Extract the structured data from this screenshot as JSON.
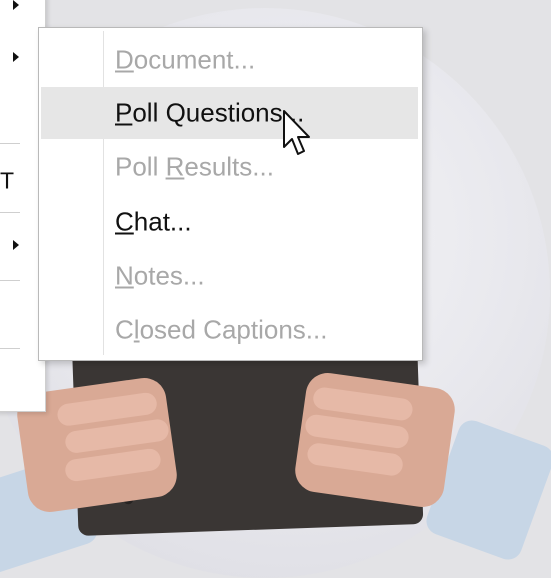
{
  "background": {
    "description_icon": "person-holding-tablet-photo"
  },
  "parent_menu": {
    "rows": [
      {
        "has_arrow": true,
        "text": ""
      },
      {
        "has_arrow": true,
        "text": ""
      },
      {
        "has_arrow": false,
        "text": ""
      },
      {
        "has_arrow": false,
        "text": "T"
      },
      {
        "has_arrow": true,
        "text": ""
      },
      {
        "has_arrow": false,
        "text": ""
      }
    ]
  },
  "submenu": {
    "items": [
      {
        "label_u": "D",
        "label_rest": "ocument...",
        "label_pre": "",
        "enabled": false
      },
      {
        "label_u": "P",
        "label_rest": "oll Questions...",
        "label_pre": "",
        "enabled": true,
        "hover": true
      },
      {
        "label_pre": "Poll ",
        "label_u": "R",
        "label_rest": "esults...",
        "enabled": false
      },
      {
        "label_pre": "",
        "label_u": "C",
        "label_rest": "hat...",
        "enabled": true
      },
      {
        "label_pre": "",
        "label_u": "N",
        "label_rest": "otes...",
        "enabled": false
      },
      {
        "label_pre": "C",
        "label_u": "l",
        "label_rest": "osed Captions...",
        "enabled": false
      }
    ]
  },
  "colors": {
    "menu_bg": "#ffffff",
    "hover_bg": "#e6e6e6",
    "disabled_text": "#a8a8a8",
    "enabled_text": "#111111"
  }
}
